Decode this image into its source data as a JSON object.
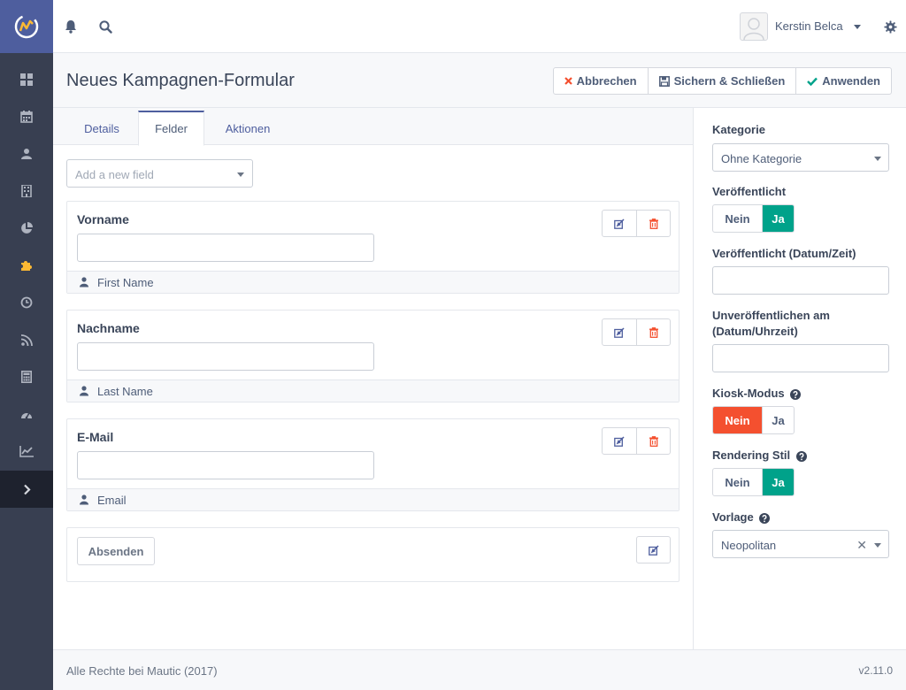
{
  "app": {
    "name": "Mautic"
  },
  "colors": {
    "nav_bg": "#383f51",
    "brand": "#4e5e9e",
    "success": "#00a28a",
    "danger": "#f4502f",
    "active_plugin": "#fdb933"
  },
  "nav": {
    "items": [
      {
        "name": "dashboard-icon"
      },
      {
        "name": "calendar-icon"
      },
      {
        "name": "user-icon"
      },
      {
        "name": "building-icon"
      },
      {
        "name": "pie-chart-icon"
      },
      {
        "name": "puzzle-icon",
        "active": true
      },
      {
        "name": "clock-icon"
      },
      {
        "name": "rss-icon"
      },
      {
        "name": "calculator-icon"
      },
      {
        "name": "dashboard-gauge-icon"
      },
      {
        "name": "line-chart-icon"
      },
      {
        "name": "chevron-right-icon"
      }
    ]
  },
  "topbar": {
    "user_name": "Kerstin Belca"
  },
  "page": {
    "title": "Neues Kampagnen-Formular",
    "buttons": {
      "cancel": "Abbrechen",
      "save_close": "Sichern & Schließen",
      "apply": "Anwenden"
    }
  },
  "tabs": [
    {
      "label": "Details"
    },
    {
      "label": "Felder",
      "active": true
    },
    {
      "label": "Aktionen"
    }
  ],
  "add_field": {
    "placeholder": "Add a new field"
  },
  "fields": [
    {
      "label": "Vorname",
      "mapped_to": "First Name"
    },
    {
      "label": "Nachname",
      "mapped_to": "Last Name"
    },
    {
      "label": "E-Mail",
      "mapped_to": "Email"
    }
  ],
  "submit": {
    "label": "Absenden"
  },
  "sidebar": {
    "category_label": "Kategorie",
    "category_value": "Ohne Kategorie",
    "published_label": "Veröffentlicht",
    "published_datetime_label": "Veröffentlicht (Datum/Zeit)",
    "unpublish_label_line1": "Unveröffentlichen am",
    "unpublish_label_line2": "(Datum/Uhrzeit)",
    "kiosk_label": "Kiosk-Modus",
    "rendering_label": "Rendering Stil",
    "template_label": "Vorlage",
    "template_value": "Neopolitan",
    "no": "Nein",
    "yes": "Ja",
    "published": "yes",
    "kiosk": "no",
    "rendering": "yes"
  },
  "footer": {
    "copyright": "Alle Rechte bei Mautic (2017)",
    "version": "v2.11.0"
  }
}
